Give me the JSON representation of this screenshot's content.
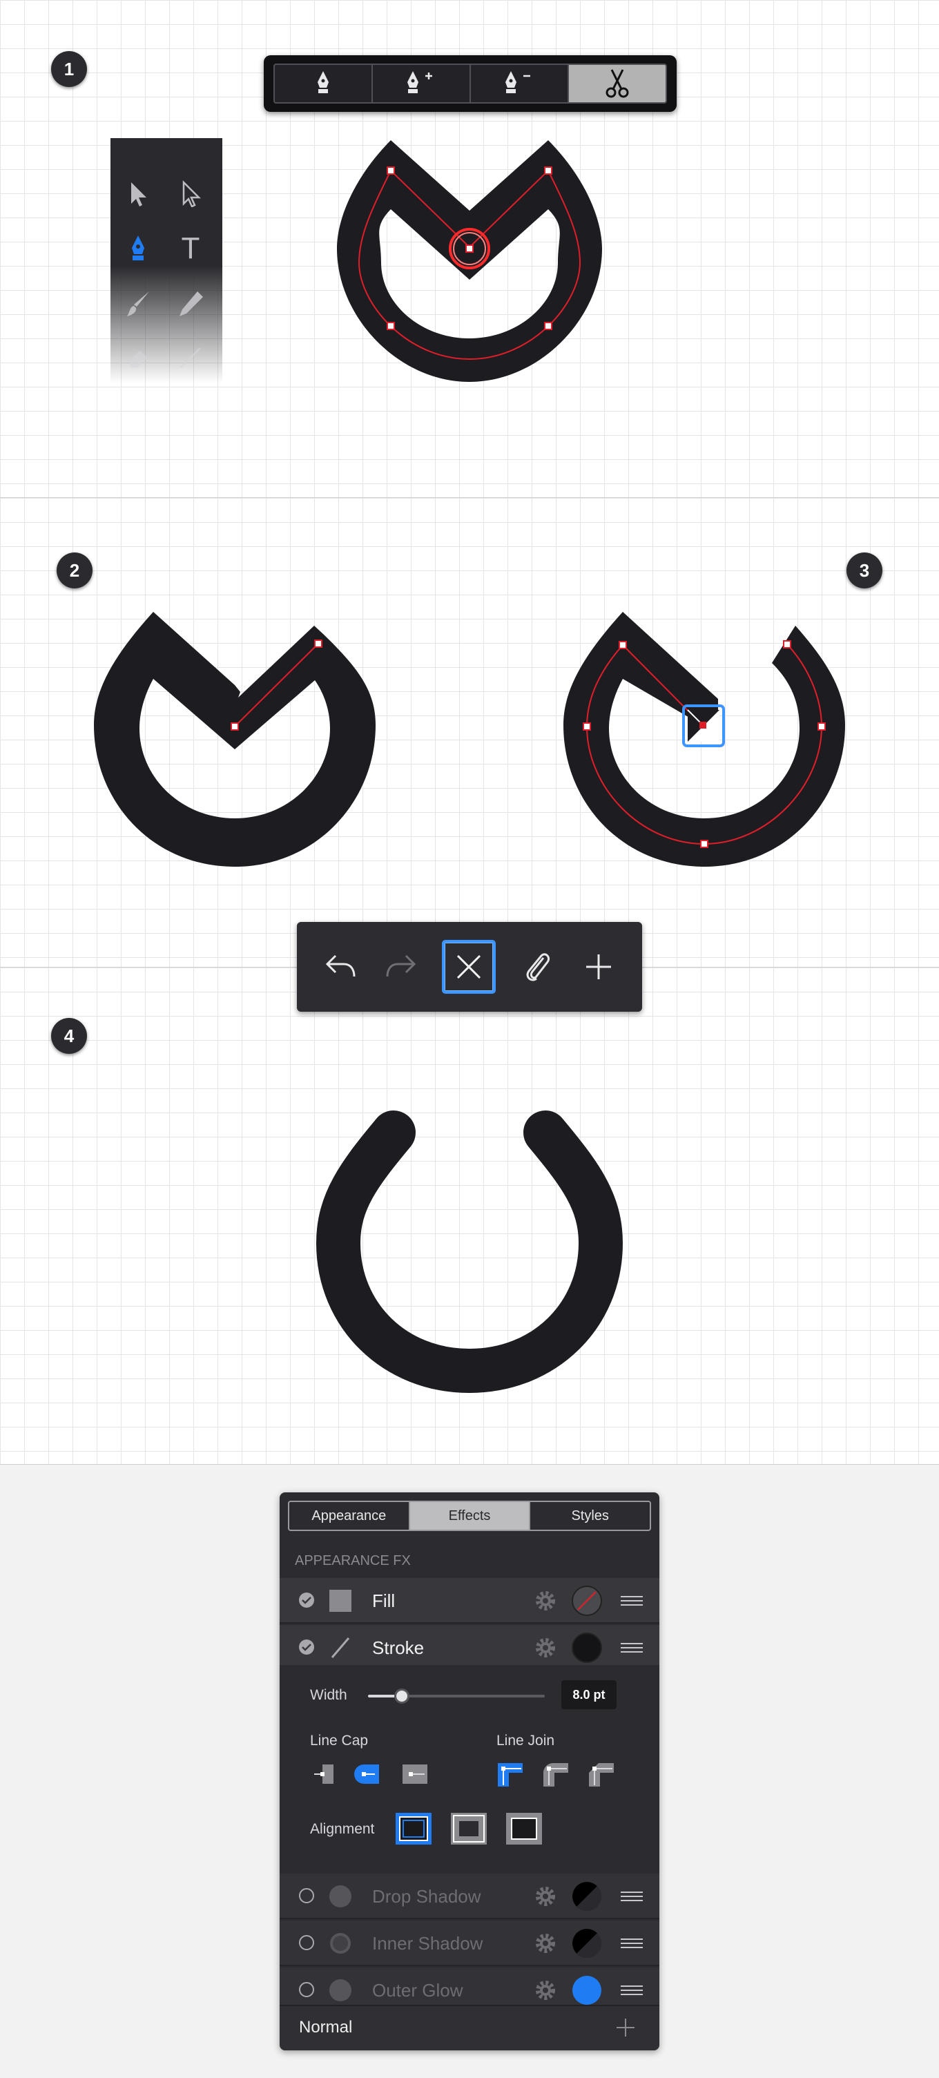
{
  "steps": {
    "s1": "1",
    "s2": "2",
    "s3": "3",
    "s4": "4"
  },
  "pen_toolbar": {
    "items": [
      "pen-icon",
      "add-anchor-icon",
      "delete-anchor-icon",
      "scissors-icon"
    ],
    "selected": "scissors-icon"
  },
  "tools_panel": {
    "items": [
      "selection-arrow-icon",
      "direct-selection-icon",
      "pen-icon",
      "text-tool-icon",
      "brush-icon",
      "pencil-icon",
      "eraser-icon",
      "line-icon"
    ],
    "selected": "pen-icon",
    "text_tool_glyph": "T"
  },
  "action_toolbar": {
    "items": [
      "undo-icon",
      "redo-icon",
      "close-icon",
      "attach-icon",
      "add-icon"
    ],
    "selected": "close-icon"
  },
  "colors": {
    "shape": "#1d1d21",
    "path": "#e01e2a",
    "accent": "#1f7cf2",
    "panel": "#2c2c30"
  },
  "appearance_panel": {
    "tabs": [
      "Appearance",
      "Effects",
      "Styles"
    ],
    "selected_tab": "Effects",
    "section_header": "APPEARANCE FX",
    "fill": {
      "label": "Fill",
      "enabled": true
    },
    "stroke": {
      "label": "Stroke",
      "enabled": true
    },
    "stroke_options": {
      "width_label": "Width",
      "width_value": "8.0 pt",
      "width_fraction": 0.19,
      "line_cap_label": "Line Cap",
      "line_cap_selected": "round-cap",
      "line_join_label": "Line Join",
      "line_join_selected": "miter-join",
      "alignment_label": "Alignment",
      "alignment_selected": "inside"
    },
    "effects": [
      {
        "label": "Drop Shadow",
        "enabled": false
      },
      {
        "label": "Inner Shadow",
        "enabled": false
      },
      {
        "label": "Outer Glow",
        "enabled": false
      }
    ],
    "footer": {
      "blend_mode": "Normal"
    }
  }
}
